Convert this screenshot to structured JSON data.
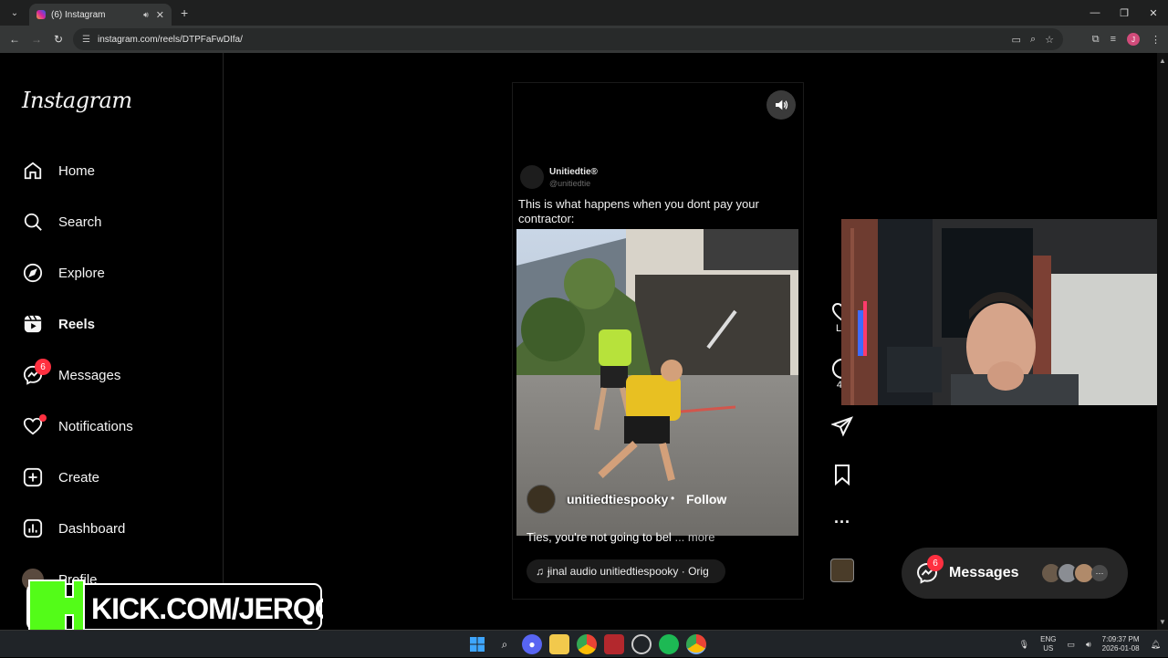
{
  "browser": {
    "tab_title": "(6) Instagram",
    "url": "instagram.com/reels/DTPFaFwDIfa/",
    "profile_initial": "J"
  },
  "sidebar": {
    "logo": "Instagram",
    "items": [
      {
        "label": "Home",
        "icon": "home-icon"
      },
      {
        "label": "Search",
        "icon": "search-icon"
      },
      {
        "label": "Explore",
        "icon": "compass-icon"
      },
      {
        "label": "Reels",
        "icon": "reels-icon"
      },
      {
        "label": "Messages",
        "icon": "messenger-icon",
        "badge": "6"
      },
      {
        "label": "Notifications",
        "icon": "heart-icon"
      },
      {
        "label": "Create",
        "icon": "plus-square-icon"
      },
      {
        "label": "Dashboard",
        "icon": "dashboard-icon"
      },
      {
        "label": "Profile",
        "icon": "avatar"
      }
    ]
  },
  "reel": {
    "tweet_name": "Unitiedtie®",
    "tweet_handle": "@unitiedtie",
    "tweet_text": "This is what happens when you dont pay your contractor:",
    "username": "unitiedtiespooky",
    "separator": "•",
    "follow_label": "Follow",
    "caption": "Ties, you're not going to bel",
    "more_label": "... more",
    "audio": "ɉinal audio   unitiedtiespooky · Orig"
  },
  "actions": {
    "like_label": "Lik",
    "comment_count": "44"
  },
  "messages_bar": {
    "label": "Messages",
    "badge": "6",
    "more": "···"
  },
  "overlay": {
    "kick_text": "KICK.COM/JERQO"
  },
  "taskbar": {
    "lang_top": "ENG",
    "lang_bottom": "US",
    "time": "7:09:37 PM",
    "date": "2026-01-08"
  },
  "colors": {
    "accent_badge": "#ff3040",
    "kick_green": "#53fc18"
  }
}
